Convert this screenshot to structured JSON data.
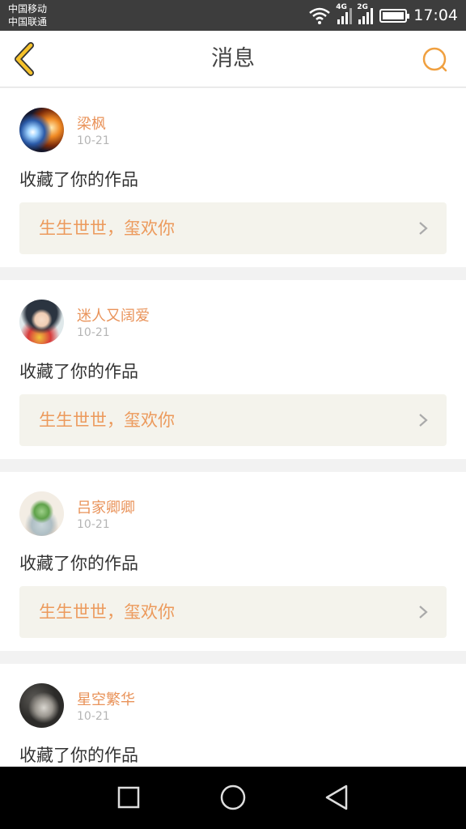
{
  "status": {
    "carrier_1": "中国移动",
    "carrier_2": "中国联通",
    "net_1": "4G",
    "net_2": "2G",
    "time": "17:04"
  },
  "header": {
    "title": "消息",
    "back_icon": "chevron-left-icon",
    "search_icon": "search-icon",
    "accent": "#f0a040"
  },
  "messages": [
    {
      "user": "梁枫",
      "date": "10-21",
      "action": "收藏了你的作品",
      "work": "生生世世，玺欢你"
    },
    {
      "user": "迷人又阔爱",
      "date": "10-21",
      "action": "收藏了你的作品",
      "work": "生生世世，玺欢你"
    },
    {
      "user": "吕家卿卿",
      "date": "10-21",
      "action": "收藏了你的作品",
      "work": "生生世世，玺欢你"
    },
    {
      "user": "星空繁华",
      "date": "10-21",
      "action": "收藏了你的作品",
      "work": ""
    }
  ],
  "colors": {
    "username": "#e9935a",
    "work_title": "#ec9a5c",
    "work_bg": "#f4f3ec"
  }
}
